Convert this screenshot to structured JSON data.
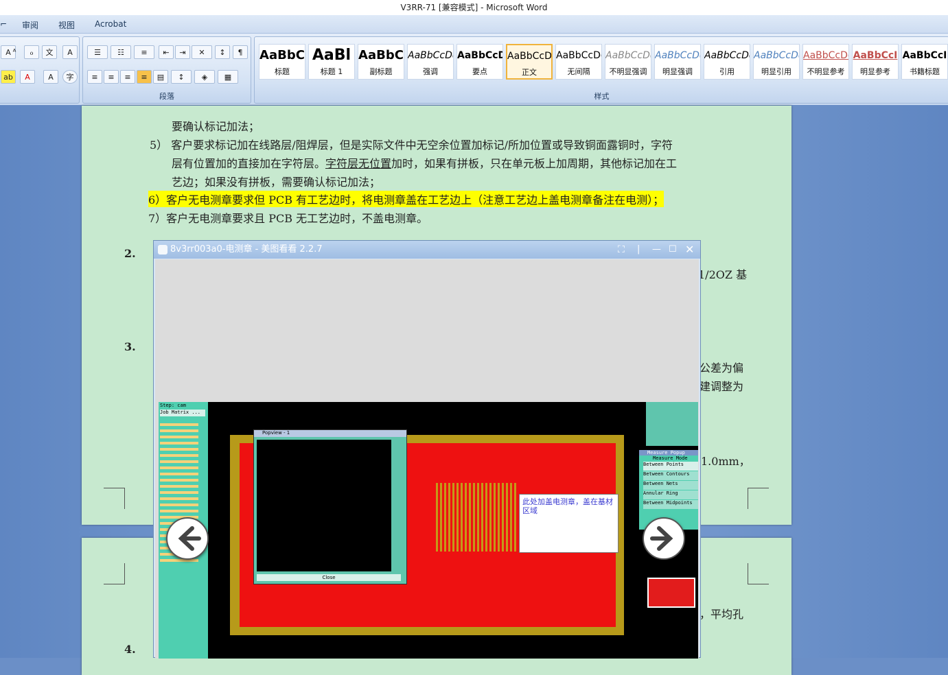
{
  "window": {
    "title": "V3RR-71 [兼容模式] - Microsoft Word"
  },
  "menu": {
    "review": "审阅",
    "view": "视图",
    "acrobat": "Acrobat"
  },
  "ribbon": {
    "paragraph_label": "段落",
    "styles_label": "样式",
    "styles": [
      {
        "sample": "AaBbC",
        "name": "标题"
      },
      {
        "sample": "AaBl",
        "name": "标题 1"
      },
      {
        "sample": "AaBbC",
        "name": "副标题"
      },
      {
        "sample": "AaBbCcDd",
        "name": "强调"
      },
      {
        "sample": "AaBbCcD",
        "name": "要点"
      },
      {
        "sample": "AaBbCcDd",
        "name": "正文"
      },
      {
        "sample": "AaBbCcDd",
        "name": "无间隔"
      },
      {
        "sample": "AaBbCcDd",
        "name": "不明显强调"
      },
      {
        "sample": "AaBbCcDd",
        "name": "明显强调"
      },
      {
        "sample": "AaBbCcDd",
        "name": "引用"
      },
      {
        "sample": "AaBbCcDd",
        "name": "明显引用"
      },
      {
        "sample": "AaBbCcDd",
        "name": "不明显参考"
      },
      {
        "sample": "AaBbCcI",
        "name": "明显参考"
      },
      {
        "sample": "AaBbCcI",
        "name": "书籍标题"
      }
    ]
  },
  "doc": {
    "line1": "要确认标记加法；",
    "line2": "5） 客户要求标记加在线路层/阻焊层，但是实际文件中无空余位置加标记/所加位置或导致铜面露铜时，字符",
    "line3a": "层有位置加的直接加在字符层。",
    "line3b": "字符层无位置",
    "line3c": "加时，如果有拼板，只在单元板上加周期，其他标记加在工",
    "line4": "艺边；如果没有拼板，需要确认标记加法；",
    "line5": "6）客户无电测章要求但 PCB 有工艺边时，将电测章盖在工艺边上（注意工艺边上盖电测章备注在电测）；",
    "line6": "7）客户无电测章要求且 PCB 无工艺边时，不盖电测章。",
    "num2": "2.",
    "num3": "3.",
    "num4": "4.",
    "frag_2oz": "1/2OZ 基",
    "frag_gongcha": "公差为偏",
    "frag_tiaozheng": "建调整为",
    "frag_10mm": "1.0mm，",
    "frag_pingjun": "，平均孔"
  },
  "viewer": {
    "title": "8v3rr003a0-电测章 - 美图看看 2.2.7",
    "cam_step": "Step: cam",
    "cam_matrix": "Job Matrix ...",
    "popview_title": "Popview - 1",
    "popview_close": "Close",
    "annotation": "此处加盖电测章，盖在基材区域",
    "measure_title": "Measure Popup",
    "measure_mode": "Measure Mode",
    "measure_items": [
      "Between Points",
      "Between Contours",
      "Between Nets",
      "Annular Ring",
      "Between Midpoints"
    ]
  }
}
